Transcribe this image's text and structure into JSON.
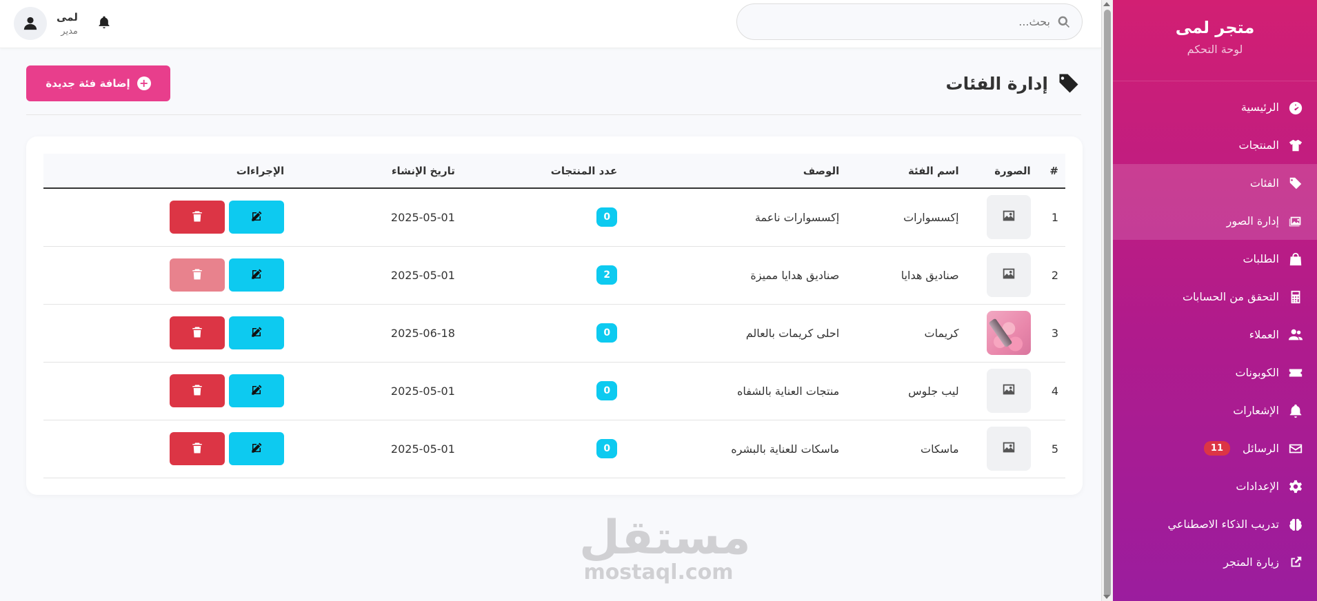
{
  "sidebar": {
    "brand_title": "متجر لمى",
    "brand_sub": "لوحة التحكم",
    "items": [
      {
        "label": "الرئيسية",
        "icon": "gauge-icon"
      },
      {
        "label": "المنتجات",
        "icon": "tshirt-icon"
      },
      {
        "label": "الفئات",
        "icon": "tags-icon",
        "active": true
      },
      {
        "label": "إدارة الصور",
        "icon": "images-icon",
        "active": true
      },
      {
        "label": "الطلبات",
        "icon": "shopping-bag-icon"
      },
      {
        "label": "التحقق من الحسابات",
        "icon": "calculator-icon"
      },
      {
        "label": "العملاء",
        "icon": "users-icon"
      },
      {
        "label": "الكوبونات",
        "icon": "ticket-icon"
      },
      {
        "label": "الإشعارات",
        "icon": "bell-icon"
      },
      {
        "label": "الرسائل",
        "icon": "envelope-icon",
        "badge": "11"
      },
      {
        "label": "الإعدادات",
        "icon": "gear-icon"
      },
      {
        "label": "تدريب الذكاء الاصطناعي",
        "icon": "brain-icon"
      },
      {
        "label": "زيارة المتجر",
        "icon": "external-link-icon"
      }
    ]
  },
  "topbar": {
    "search_placeholder": "بحث...",
    "user_name": "لمى",
    "user_role": "مدير"
  },
  "page": {
    "title": "إدارة الفئات",
    "add_button": "إضافة فئة جديدة"
  },
  "table": {
    "headers": [
      "#",
      "الصورة",
      "اسم الفئة",
      "الوصف",
      "عدد المنتجات",
      "تاريخ الإنشاء",
      "الإجراءات"
    ],
    "rows": [
      {
        "num": "1",
        "image": "placeholder",
        "name": "إكسسوارات",
        "desc": "إكسسوارات ناعمة",
        "count": "0",
        "date": "2025-05-01",
        "delete_disabled": false
      },
      {
        "num": "2",
        "image": "placeholder",
        "name": "صناديق هدايا",
        "desc": "صناديق هدايا مميزة",
        "count": "2",
        "date": "2025-05-01",
        "delete_disabled": true
      },
      {
        "num": "3",
        "image": "photo",
        "name": "كريمات",
        "desc": "احلى كريمات بالعالم",
        "count": "0",
        "date": "2025-06-18",
        "delete_disabled": false
      },
      {
        "num": "4",
        "image": "placeholder",
        "name": "ليب جلوس",
        "desc": "منتجات العناية بالشفاه",
        "count": "0",
        "date": "2025-05-01",
        "delete_disabled": false
      },
      {
        "num": "5",
        "image": "placeholder",
        "name": "ماسكات",
        "desc": "ماسكات للعناية بالبشره",
        "count": "0",
        "date": "2025-05-01",
        "delete_disabled": false
      }
    ]
  },
  "watermark": {
    "arabic": "مستقل",
    "latin": "mostaql.com"
  },
  "colors": {
    "sidebar_top": "#d21f73",
    "sidebar_bottom": "#9b1d9e",
    "accent_pink": "#e83e8c",
    "info": "#0dcaf0",
    "danger": "#dc3545"
  }
}
